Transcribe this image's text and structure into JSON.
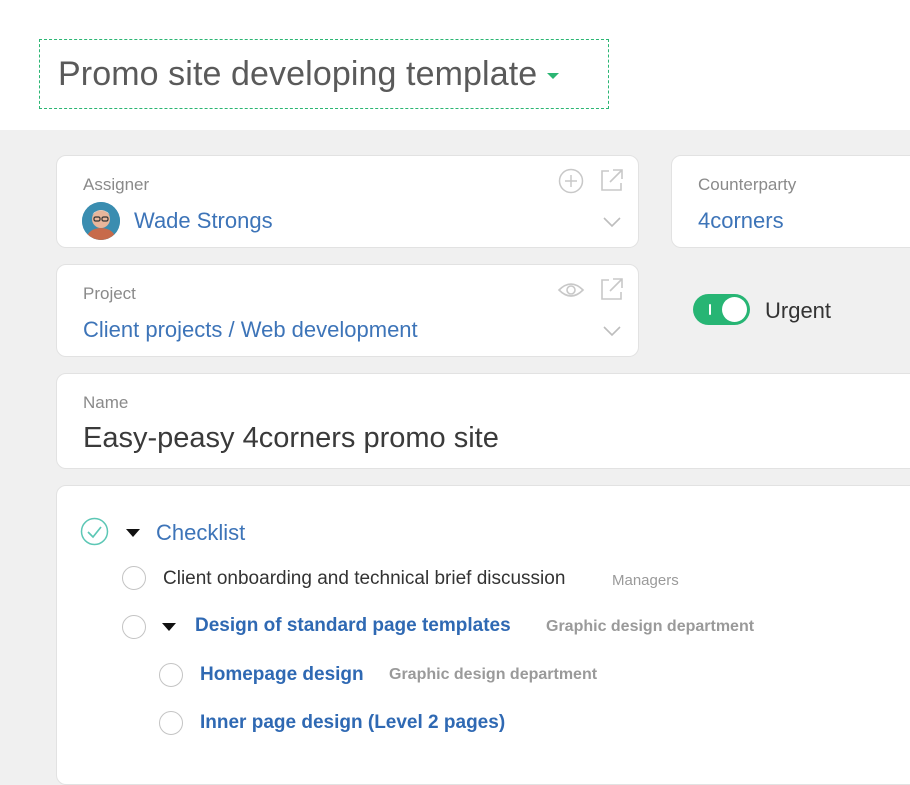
{
  "header": {
    "title": "Promo site developing template"
  },
  "assigner": {
    "label": "Assigner",
    "value": "Wade Strongs"
  },
  "counterparty": {
    "label": "Counterparty",
    "value": "4corners"
  },
  "project": {
    "label": "Project",
    "value": "Client projects / Web development"
  },
  "urgent": {
    "label": "Urgent",
    "enabled": true
  },
  "name": {
    "label": "Name",
    "value": "Easy-peasy 4corners promo site"
  },
  "checklist": {
    "title": "Checklist",
    "items": [
      {
        "text": "Client onboarding and technical brief discussion",
        "dept": "Managers"
      },
      {
        "text": "Design of standard page templates",
        "dept": "Graphic design department"
      },
      {
        "text": "Homepage design",
        "dept": "Graphic design department"
      },
      {
        "text": "Inner page design (Level 2 pages)",
        "dept": ""
      }
    ]
  },
  "colors": {
    "accent": "#27b574",
    "link": "#3d74b8",
    "dashed_border": "#2bb673"
  }
}
